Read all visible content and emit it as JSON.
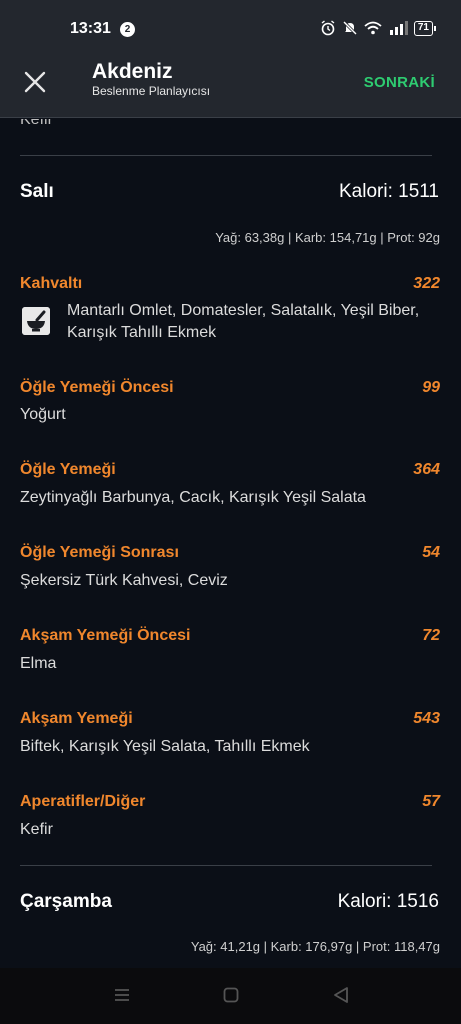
{
  "status_bar": {
    "time": "13:31",
    "notification_count": "2",
    "battery": "71"
  },
  "app_bar": {
    "title": "Akdeniz",
    "subtitle": "Beslenme Planlayıcısı",
    "next_label": "SONRAKİ"
  },
  "previous_tail": "Kefir",
  "days": [
    {
      "name": "Salı",
      "calories": "Kalori: 1511",
      "macros": "Yağ: 63,38g | Karb: 154,71g | Prot: 92g",
      "meals": [
        {
          "title": "Kahvaltı",
          "calories": "322",
          "items": "Mantarlı Omlet, Domatesler, Salatalık, Yeşil Biber, Karışık Tahıllı Ekmek"
        },
        {
          "title": "Öğle Yemeği Öncesi",
          "calories": "99",
          "items": "Yoğurt"
        },
        {
          "title": "Öğle Yemeği",
          "calories": "364",
          "items": "Zeytinyağlı Barbunya, Cacık, Karışık Yeşil Salata"
        },
        {
          "title": "Öğle Yemeği Sonrası",
          "calories": "54",
          "items": "Şekersiz Türk Kahvesi, Ceviz"
        },
        {
          "title": "Akşam Yemeği Öncesi",
          "calories": "72",
          "items": "Elma"
        },
        {
          "title": "Akşam Yemeği",
          "calories": "543",
          "items": "Biftek, Karışık Yeşil Salata, Tahıllı Ekmek"
        },
        {
          "title": "Aperatifler/Diğer",
          "calories": "57",
          "items": "Kefir"
        }
      ]
    },
    {
      "name": "Çarşamba",
      "calories": "Kalori: 1516",
      "macros": "Yağ: 41,21g | Karb: 176,97g | Prot: 118,47g"
    }
  ],
  "colors": {
    "accent_orange": "#f0872d",
    "next_green": "#2ecc71",
    "background": "#0b0f17",
    "bar_background": "#23272e"
  },
  "icons": [
    "close-icon",
    "mortar-pestle-icon",
    "alarm-icon",
    "mute-icon",
    "wifi-icon",
    "signal-icon",
    "battery-icon",
    "menu-nav-icon",
    "home-nav-icon",
    "back-nav-icon"
  ]
}
